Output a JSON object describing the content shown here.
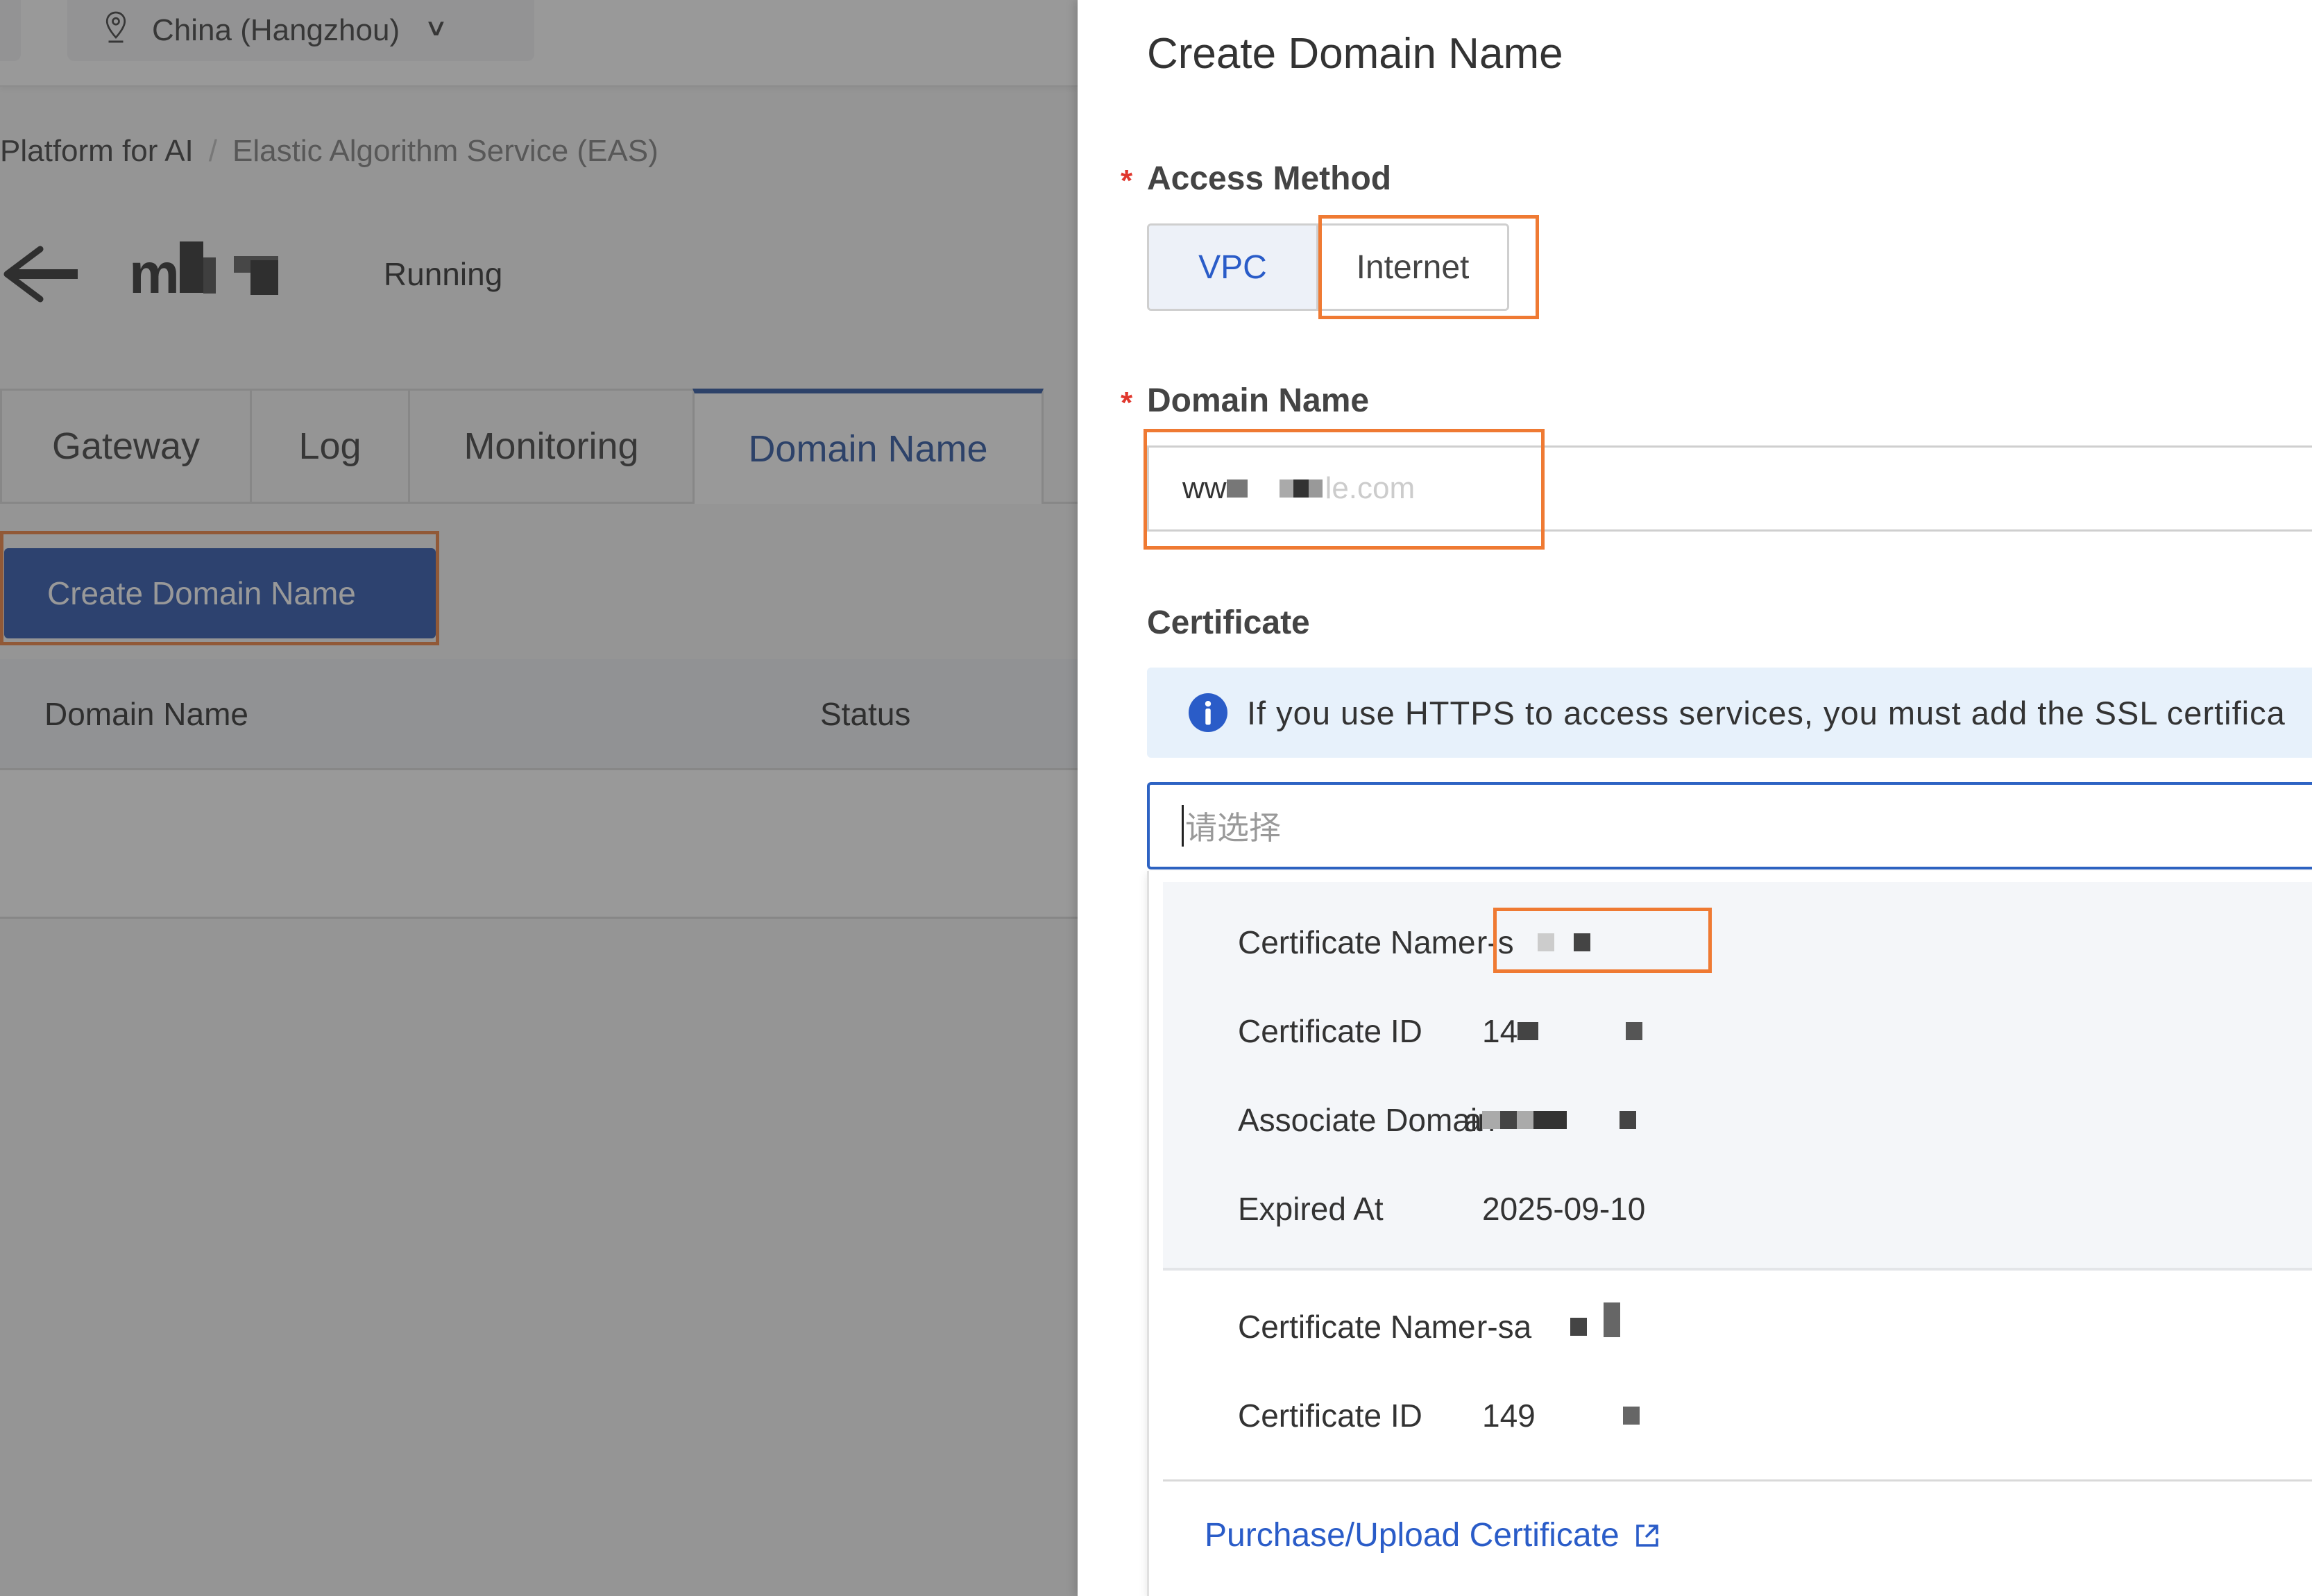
{
  "background_page": {
    "region_selector": {
      "label": "China (Hangzhou)",
      "icon": "map-pin-icon"
    },
    "breadcrumb": [
      "Platform for AI",
      "Elastic Algorithm Service (EAS)"
    ],
    "breadcrumb_separator": "/",
    "service": {
      "name_prefix": "m",
      "status": "Running"
    },
    "tabs": [
      {
        "label": "Gateway",
        "active": false
      },
      {
        "label": "Log",
        "active": false
      },
      {
        "label": "Monitoring",
        "active": false
      },
      {
        "label": "Domain Name",
        "active": true
      }
    ],
    "create_button_label": "Create Domain Name",
    "table": {
      "columns": [
        "Domain Name",
        "Status"
      ],
      "rows": []
    }
  },
  "drawer": {
    "title": "Create Domain Name",
    "access_method": {
      "label": "Access Method",
      "required_mark": "*",
      "options": [
        "VPC",
        "Internet"
      ],
      "selected": "Internet"
    },
    "domain_name": {
      "label": "Domain Name",
      "required_mark": "*",
      "value_visible_prefix": "ww",
      "value_visible_suffix": "le.com"
    },
    "certificate": {
      "label": "Certificate",
      "alert": "If you use HTTPS to access services, you must add the SSL certifica",
      "select_placeholder": "请选择",
      "options": [
        {
          "selected": true,
          "fields": [
            {
              "key": "Certificate Name",
              "value": "r-s"
            },
            {
              "key": "Certificate ID",
              "value": "14"
            },
            {
              "key": "Associate Domain",
              "value": "a"
            },
            {
              "key": "Expired At",
              "value": "2025-09-10"
            }
          ]
        },
        {
          "selected": false,
          "fields": [
            {
              "key": "Certificate Name",
              "value": "r-sa"
            },
            {
              "key": "Certificate ID",
              "value": "149"
            }
          ]
        }
      ],
      "purchase_link": "Purchase/Upload Certificate"
    }
  },
  "colors": {
    "primary": "#1f4aa8",
    "link": "#2a5cc8",
    "highlight": "#ef7a33",
    "required": "#e0362c",
    "alert_bg": "#e7f1fb"
  }
}
